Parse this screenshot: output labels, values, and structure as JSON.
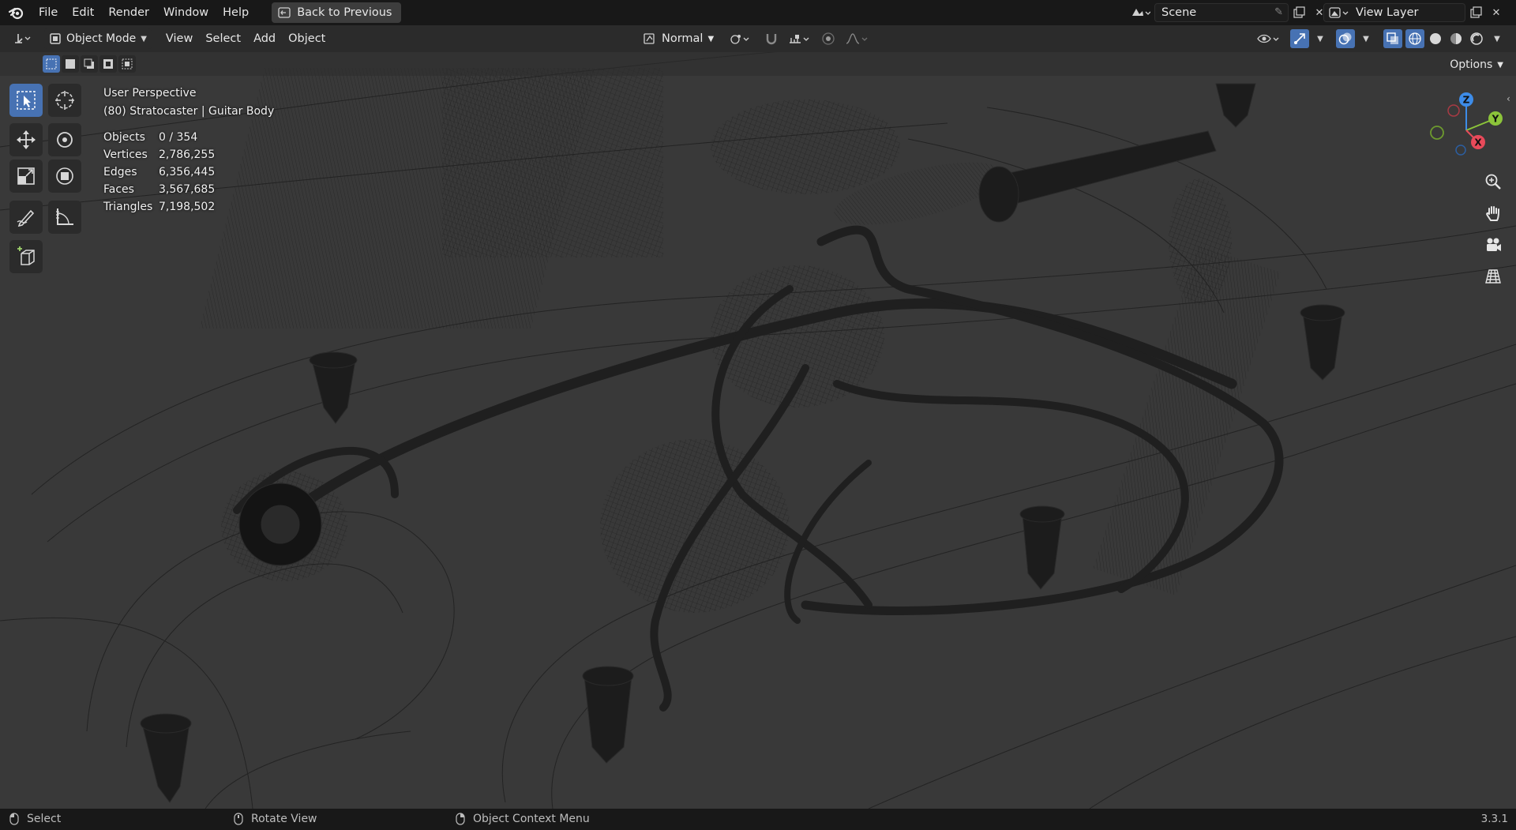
{
  "topbar": {
    "menus": [
      "File",
      "Edit",
      "Render",
      "Window",
      "Help"
    ],
    "back_button": "Back to Previous",
    "scene": "Scene",
    "view_layer": "View Layer"
  },
  "viewport_header": {
    "mode": "Object Mode",
    "menus": [
      "View",
      "Select",
      "Add",
      "Object"
    ],
    "transform_orientation": "Normal"
  },
  "tool_settings": {
    "options_label": "Options"
  },
  "overlay": {
    "view_name": "User Perspective",
    "object_context": "(80) Stratocaster | Guitar Body",
    "stats": [
      {
        "label": "Objects",
        "value": "0 / 354"
      },
      {
        "label": "Vertices",
        "value": "2,786,255"
      },
      {
        "label": "Edges",
        "value": "6,356,445"
      },
      {
        "label": "Faces",
        "value": "3,567,685"
      },
      {
        "label": "Triangles",
        "value": "7,198,502"
      }
    ]
  },
  "gizmo": {
    "z": "Z",
    "y": "Y",
    "x": "X"
  },
  "statusbar": {
    "left_click": "Select",
    "middle_click": "Rotate View",
    "right_click": "Object Context Menu",
    "version": "3.3.1"
  },
  "colors": {
    "accent": "#4772b3",
    "viewport_bg": "#393939",
    "axis_x": "#e84a5a",
    "axis_y": "#8cc43a",
    "axis_z": "#3d8ce8"
  }
}
